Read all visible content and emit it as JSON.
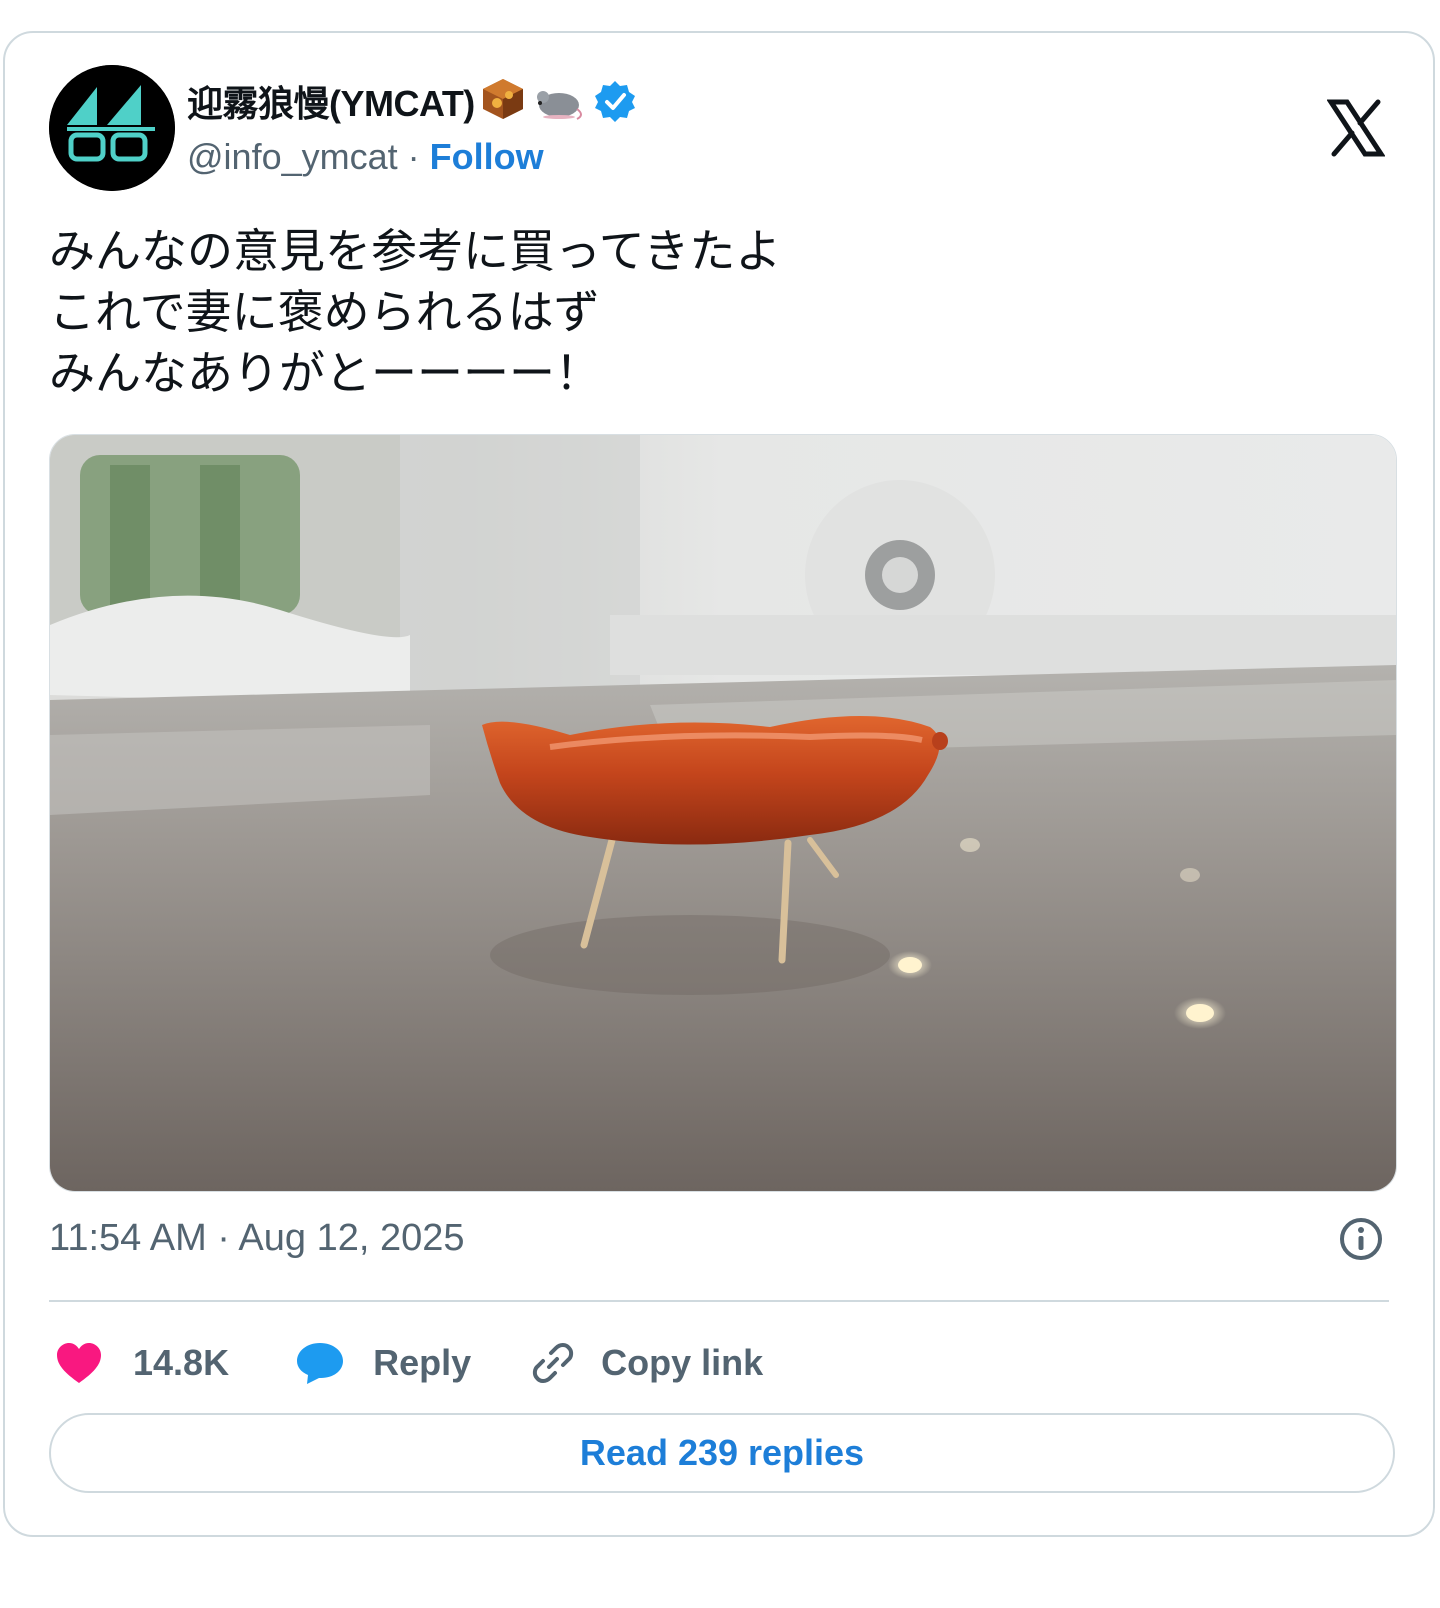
{
  "author": {
    "display_name": "迎霧狼慢(YMCAT)",
    "name_emojis": [
      "cube-emoji",
      "mouse-emoji"
    ],
    "verified": true,
    "handle": "@info_ymcat",
    "separator": "·",
    "follow_label": "Follow"
  },
  "tweet": {
    "lines": [
      "みんなの意見を参考に買ってきたよ",
      "これで妻に褒められるはず",
      "みんなありがとーーーー！"
    ],
    "timestamp": "11:54 AM · Aug 12, 2025"
  },
  "actions": {
    "likes": "14.8K",
    "reply_label": "Reply",
    "copy_link_label": "Copy link"
  },
  "read_replies_label": "Read 239 replies",
  "colors": {
    "accent": "#1d7ed8",
    "like": "#f91880",
    "reply": "#1d9bf0",
    "verified": "#1d9bf0",
    "muted": "#536471",
    "border": "#cfd9de"
  },
  "icons": {
    "brand": "x-logo-icon",
    "info": "info-icon",
    "like": "heart-icon",
    "reply": "speech-bubble-icon",
    "copy": "link-icon"
  }
}
